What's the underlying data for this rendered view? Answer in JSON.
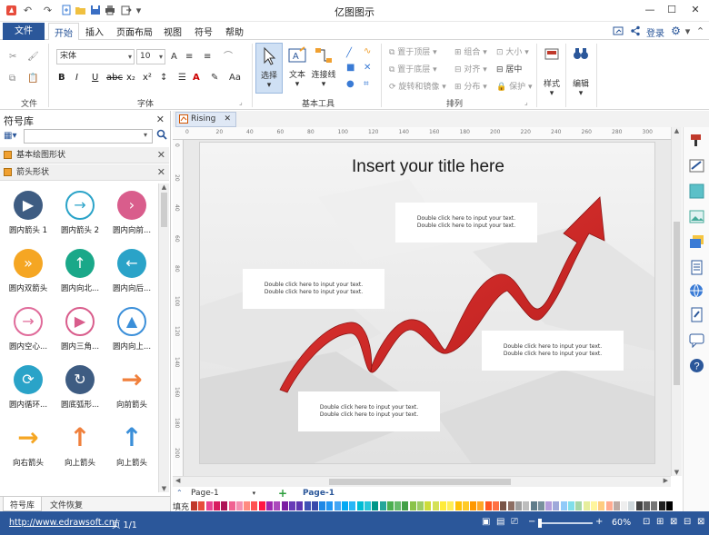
{
  "app": {
    "title": "亿图图示"
  },
  "menu": {
    "file": "文件",
    "tabs": [
      "开始",
      "插入",
      "页面布局",
      "视图",
      "符号",
      "帮助"
    ],
    "login": "登录"
  },
  "ribbon": {
    "groups": {
      "file": "文件",
      "font": "字体",
      "basic_tools": "基本工具",
      "arrange": "排列"
    },
    "font_name": "宋体",
    "font_size": "10",
    "format_buttons": [
      "B",
      "I",
      "U",
      "abc",
      "x₂",
      "x²"
    ],
    "tools": {
      "select": "选择",
      "text": "文本",
      "connector": "连接线"
    },
    "arrange_items": {
      "bring_front": "置于顶层",
      "send_back": "置于底层",
      "rotate_mirror": "旋转和镜像",
      "group": "组合",
      "align": "对齐",
      "distribute": "分布",
      "size": "大小",
      "center": "居中",
      "protect": "保护"
    },
    "style": "样式",
    "edit": "编辑"
  },
  "library": {
    "title": "符号库",
    "search_placeholder": "",
    "sections": [
      "基本绘图形状",
      "箭头形状"
    ],
    "symbols": [
      {
        "label": "圆内箭头 1",
        "icon": "play-circle-icon",
        "color": "#3e5c82",
        "glyph": "▶",
        "style": "filled"
      },
      {
        "label": "圆内箭头 2",
        "icon": "arrow-right-circle-icon",
        "color": "#2aa3c8",
        "glyph": "→",
        "style": "outline"
      },
      {
        "label": "圆内向前...",
        "icon": "chevron-right-circle-icon",
        "color": "#d95d8c",
        "glyph": "›",
        "style": "filled"
      },
      {
        "label": "圆内双箭头",
        "icon": "double-chevron-circle-icon",
        "color": "#f5a623",
        "glyph": "»",
        "style": "filled"
      },
      {
        "label": "圆内向北...",
        "icon": "arrow-up-circle-icon",
        "color": "#1aa889",
        "glyph": "↑",
        "style": "filled"
      },
      {
        "label": "圆内向后...",
        "icon": "arrow-left-circle-icon",
        "color": "#2aa3c8",
        "glyph": "←",
        "style": "filled"
      },
      {
        "label": "圆内空心...",
        "icon": "hollow-arrow-circle-icon",
        "color": "#e06b9a",
        "glyph": "→",
        "style": "outline"
      },
      {
        "label": "圆内三角...",
        "icon": "triangle-circle-icon",
        "color": "#d95d8c",
        "glyph": "▶",
        "style": "outline"
      },
      {
        "label": "圆内向上...",
        "icon": "triangle-up-circle-icon",
        "color": "#3b8fd9",
        "glyph": "▲",
        "style": "outline"
      },
      {
        "label": "圆内循环...",
        "icon": "cycle-circle-icon",
        "color": "#2aa3c8",
        "glyph": "⟳",
        "style": "filled"
      },
      {
        "label": "圆底弧形...",
        "icon": "arc-arrow-circle-icon",
        "color": "#3e5c82",
        "glyph": "↻",
        "style": "filled"
      },
      {
        "label": "向前箭头",
        "icon": "arrow-forward-icon",
        "color": "#f0803c",
        "glyph": "→",
        "style": "plain"
      },
      {
        "label": "向右箭头",
        "icon": "arrow-right-icon",
        "color": "#f5a623",
        "glyph": "→",
        "style": "plain"
      },
      {
        "label": "向上箭头",
        "icon": "arrow-up-orange-icon",
        "color": "#f0803c",
        "glyph": "↑",
        "style": "plain"
      },
      {
        "label": "向上箭头",
        "icon": "arrow-up-blue-icon",
        "color": "#3b8fd9",
        "glyph": "↑",
        "style": "plain"
      }
    ],
    "bottom_tabs": [
      "符号库",
      "文件恢复"
    ]
  },
  "document": {
    "tab": "Rising",
    "title": "Insert your title here",
    "textbox_line1": "Double click here to input your text.",
    "textbox_line2": "Double click here to input your text.",
    "ruler_h": [
      "0",
      "20",
      "40",
      "60",
      "80",
      "100",
      "120",
      "140",
      "160",
      "180",
      "200",
      "220",
      "240",
      "260",
      "280",
      "300"
    ],
    "ruler_v": [
      "0",
      "20",
      "40",
      "60",
      "80",
      "100",
      "120",
      "140",
      "160",
      "180",
      "200"
    ]
  },
  "pages": {
    "dropdown": "Page-1",
    "active": "Page-1"
  },
  "palette": {
    "label": "填充",
    "colors": [
      "#c0392b",
      "#e74c3c",
      "#e84393",
      "#d81b60",
      "#ad1457",
      "#f06292",
      "#f48fb1",
      "#ff8a80",
      "#ff5252",
      "#ff1744",
      "#9c27b0",
      "#ab47bc",
      "#7b1fa2",
      "#673ab7",
      "#5e35b1",
      "#3f51b5",
      "#3949ab",
      "#1e88e5",
      "#2196f3",
      "#42a5f5",
      "#03a9f4",
      "#29b6f6",
      "#00bcd4",
      "#26c6da",
      "#009688",
      "#26a69a",
      "#4caf50",
      "#66bb6a",
      "#43a047",
      "#8bc34a",
      "#9ccc65",
      "#cddc39",
      "#d4e157",
      "#ffeb3b",
      "#ffee58",
      "#ffc107",
      "#ffca28",
      "#ff9800",
      "#ffa726",
      "#ff5722",
      "#ff7043",
      "#795548",
      "#8d6e63",
      "#9e9e9e",
      "#bdbdbd",
      "#607d8b",
      "#78909c",
      "#b39ddb",
      "#9fa8da",
      "#90caf9",
      "#80deea",
      "#a5d6a7",
      "#e6ee9c",
      "#fff59d",
      "#ffcc80",
      "#ffab91",
      "#bcaaa4",
      "#eeeeee",
      "#cfd8dc",
      "#424242",
      "#616161",
      "#757575",
      "#212121",
      "#000000"
    ]
  },
  "status": {
    "url": "http://www.edrawsoft.cn/",
    "page": "页 1/1",
    "zoom": "60%"
  }
}
